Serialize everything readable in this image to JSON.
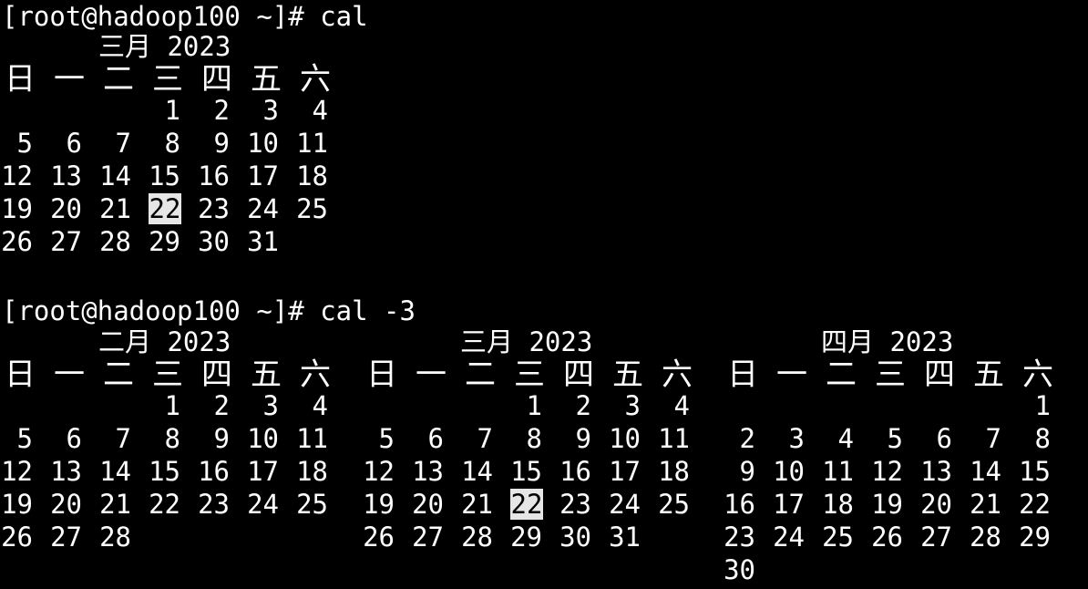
{
  "terminal": {
    "bg_color": "#000000",
    "fg_color": "#ffffff",
    "highlight_bg": "#e6e6e6",
    "highlight_fg": "#000000",
    "prompt1": "[root@hadoop100 ~]# cal",
    "prompt2": "[root@hadoop100 ~]# cal -3"
  },
  "weekdays": [
    "日",
    "一",
    "二",
    "三",
    "四",
    "五",
    "六"
  ],
  "cal1": {
    "title": "三月 2023",
    "weeks": [
      [
        "",
        "",
        "",
        "1",
        "2",
        "3",
        "4"
      ],
      [
        "5",
        "6",
        "7",
        "8",
        "9",
        "10",
        "11"
      ],
      [
        "12",
        "13",
        "14",
        "15",
        "16",
        "17",
        "18"
      ],
      [
        "19",
        "20",
        "21",
        "22",
        "23",
        "24",
        "25"
      ],
      [
        "26",
        "27",
        "28",
        "29",
        "30",
        "31",
        ""
      ]
    ],
    "today": "22"
  },
  "cal3": [
    {
      "title": "二月 2023",
      "weeks": [
        [
          "",
          "",
          "",
          "1",
          "2",
          "3",
          "4"
        ],
        [
          "5",
          "6",
          "7",
          "8",
          "9",
          "10",
          "11"
        ],
        [
          "12",
          "13",
          "14",
          "15",
          "16",
          "17",
          "18"
        ],
        [
          "19",
          "20",
          "21",
          "22",
          "23",
          "24",
          "25"
        ],
        [
          "26",
          "27",
          "28",
          "",
          "",
          "",
          ""
        ]
      ],
      "today": ""
    },
    {
      "title": "三月 2023",
      "weeks": [
        [
          "",
          "",
          "",
          "1",
          "2",
          "3",
          "4"
        ],
        [
          "5",
          "6",
          "7",
          "8",
          "9",
          "10",
          "11"
        ],
        [
          "12",
          "13",
          "14",
          "15",
          "16",
          "17",
          "18"
        ],
        [
          "19",
          "20",
          "21",
          "22",
          "23",
          "24",
          "25"
        ],
        [
          "26",
          "27",
          "28",
          "29",
          "30",
          "31",
          ""
        ]
      ],
      "today": "22"
    },
    {
      "title": "四月 2023",
      "weeks": [
        [
          "",
          "",
          "",
          "",
          "",
          "",
          "1"
        ],
        [
          "2",
          "3",
          "4",
          "5",
          "6",
          "7",
          "8"
        ],
        [
          "9",
          "10",
          "11",
          "12",
          "13",
          "14",
          "15"
        ],
        [
          "16",
          "17",
          "18",
          "19",
          "20",
          "21",
          "22"
        ],
        [
          "23",
          "24",
          "25",
          "26",
          "27",
          "28",
          "29"
        ],
        [
          "30",
          "",
          "",
          "",
          "",
          "",
          ""
        ]
      ],
      "today": ""
    }
  ]
}
